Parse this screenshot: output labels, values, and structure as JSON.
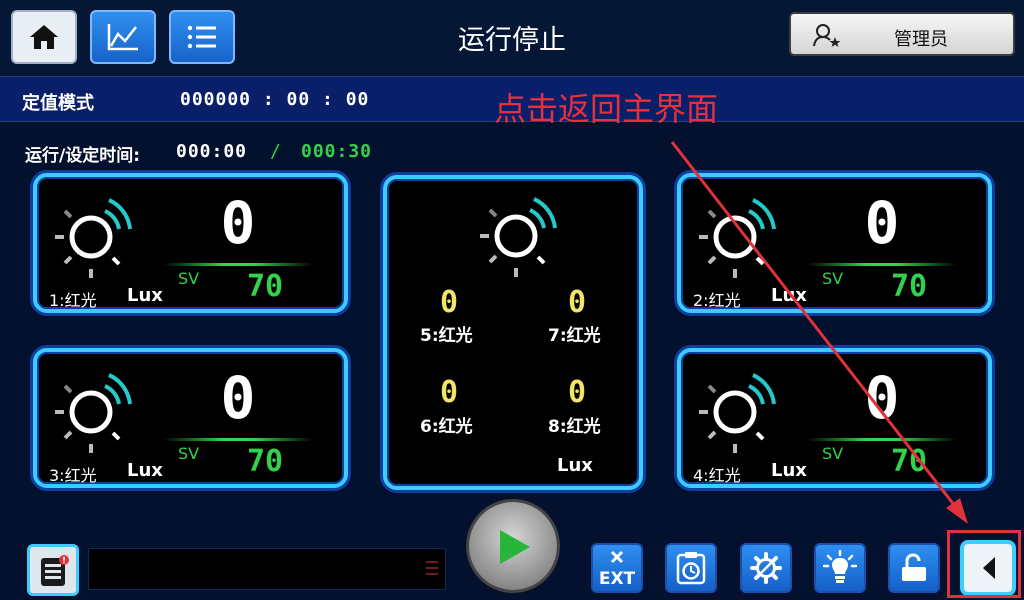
{
  "header": {
    "title": "运行停止",
    "user_label": "管理员",
    "nav_icons": [
      "home-icon",
      "trend-chart-icon",
      "list-icon"
    ]
  },
  "mode": {
    "name": "定值模式",
    "counter": "000000 : 00 : 00"
  },
  "annotation": "点击返回主界面",
  "time": {
    "label": "运行/设定时间:",
    "run": "000:00",
    "separator": "/",
    "set": "000:30"
  },
  "panels": [
    {
      "channel": "1:红光",
      "value": "0",
      "sv_label": "SV",
      "sv_value": "70",
      "unit": "Lux"
    },
    {
      "channel": "2:红光",
      "value": "0",
      "sv_label": "SV",
      "sv_value": "70",
      "unit": "Lux"
    },
    {
      "channel": "3:红光",
      "value": "0",
      "sv_label": "SV",
      "sv_value": "70",
      "unit": "Lux"
    },
    {
      "channel": "4:红光",
      "value": "0",
      "sv_label": "SV",
      "sv_value": "70",
      "unit": "Lux"
    }
  ],
  "center_panel": {
    "channels": [
      {
        "label": "5:红光",
        "value": "0"
      },
      {
        "label": "7:红光",
        "value": "0"
      },
      {
        "label": "6:红光",
        "value": "0"
      },
      {
        "label": "8:红光",
        "value": "0"
      }
    ],
    "unit": "Lux"
  },
  "footer": {
    "ext_label": "EXT",
    "tools": [
      "exit-icon",
      "clipboard-clock-icon",
      "settings-gear-icon",
      "lightbulb-icon",
      "unlock-icon"
    ],
    "colors": {
      "accent": "#3ecbff",
      "value_green": "#33d24a",
      "value_yellow": "#f2e36a",
      "annotation_red": "#e0323a"
    }
  }
}
